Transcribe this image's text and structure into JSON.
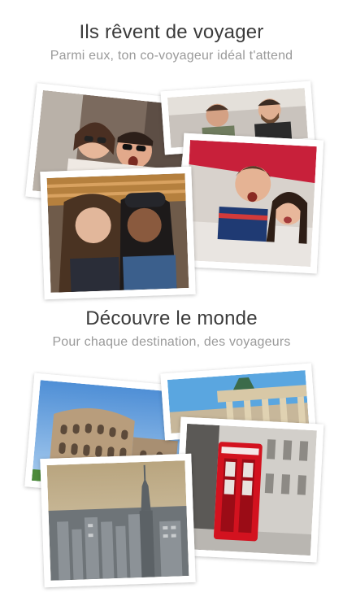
{
  "sections": [
    {
      "title": "Ils rêvent de voyager",
      "subtitle": "Parmi eux, ton co-voyageur idéal t'attend"
    },
    {
      "title": "Découvre le monde",
      "subtitle": "Pour chaque destination, des voyageurs"
    }
  ],
  "colors": {
    "title": "#3b3b3b",
    "subtitle": "#9a9a9a",
    "photo_border": "#ffffff"
  }
}
